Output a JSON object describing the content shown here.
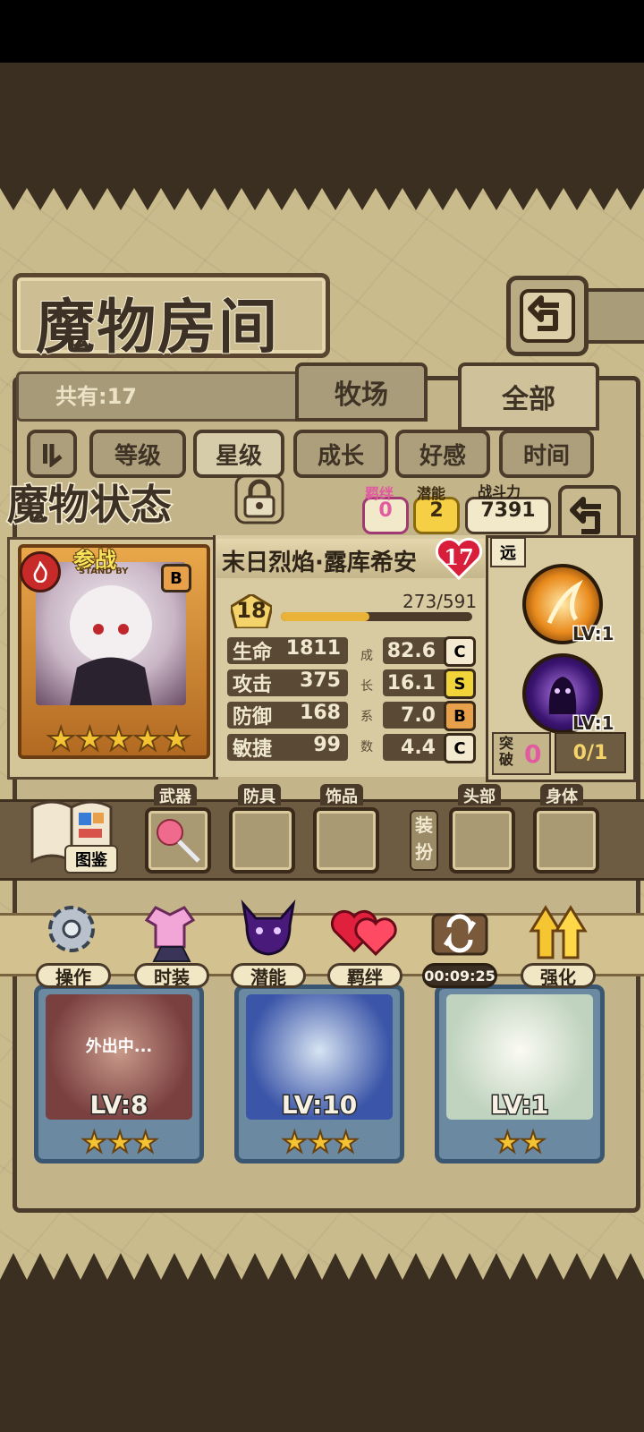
{
  "header": {
    "title": "魔物房间"
  },
  "room": {
    "count_text": "共有:17",
    "tab_pasture": "牧场",
    "tab_all": "全部"
  },
  "sort": {
    "items": [
      "等级",
      "星级",
      "成长",
      "好感",
      "时间"
    ],
    "selected": "星级"
  },
  "status": {
    "title": "魔物状态",
    "bond_label": "羁绊",
    "bond_value": "0",
    "potential_label": "潜能",
    "potential_value": "2",
    "power_label": "战斗力",
    "power_value": "7391"
  },
  "monster": {
    "deploy_text": "参战",
    "deploy_sub": "STAND BY",
    "rank": "B",
    "name": "末日烈焰·露库希安",
    "affection": "17",
    "level": "18",
    "exp_text": "273/591",
    "exp_fraction": 0.462,
    "stars": 5,
    "stats": [
      {
        "label": "生命",
        "value": "1811",
        "growth": "82.6",
        "grade": "C"
      },
      {
        "label": "攻击",
        "value": "375",
        "growth": "16.1",
        "grade": "S"
      },
      {
        "label": "防御",
        "value": "168",
        "growth": "7.0",
        "grade": "B"
      },
      {
        "label": "敏捷",
        "value": "99",
        "growth": "4.4",
        "grade": "C"
      }
    ],
    "growth_vertical": [
      "成",
      "长",
      "系",
      "数"
    ],
    "range_tag": "远",
    "skills": [
      {
        "level": "LV:1",
        "color": "#e98a1c"
      },
      {
        "level": "LV:1",
        "color": "#6a2ca0"
      }
    ],
    "breakthrough_label_1": "突",
    "breakthrough_label_2": "破",
    "breakthrough_value": "0",
    "breakthrough_progress": "0/1"
  },
  "equipment": {
    "book_label": "图鉴",
    "slots": [
      "武器",
      "防具",
      "饰品"
    ],
    "dress_label_1": "装",
    "dress_label_2": "扮",
    "dress_slots": [
      "头部",
      "身体"
    ]
  },
  "actions": [
    {
      "label": "操作",
      "icon": "gear-icon"
    },
    {
      "label": "时装",
      "icon": "outfit-icon"
    },
    {
      "label": "潜能",
      "icon": "devil-icon"
    },
    {
      "label": "羁绊",
      "icon": "hearts-icon"
    },
    {
      "label": "00:09:25",
      "icon": "chest-refresh-icon"
    },
    {
      "label": "强化",
      "icon": "upgrade-arrows-icon"
    }
  ],
  "monster_cards": [
    {
      "level": "LV:8",
      "status": "外出中...",
      "stars": 3
    },
    {
      "level": "LV:10",
      "status": "",
      "stars": 3
    },
    {
      "level": "LV:1",
      "status": "",
      "stars": 2
    }
  ],
  "colors": {
    "grade_C": "#f3ead0",
    "grade_S": "#f1d33a",
    "grade_B": "#e8a04a",
    "exp_fill": "#e9b33a",
    "pink": "#e25aa0",
    "gold": "#e9b33a"
  }
}
